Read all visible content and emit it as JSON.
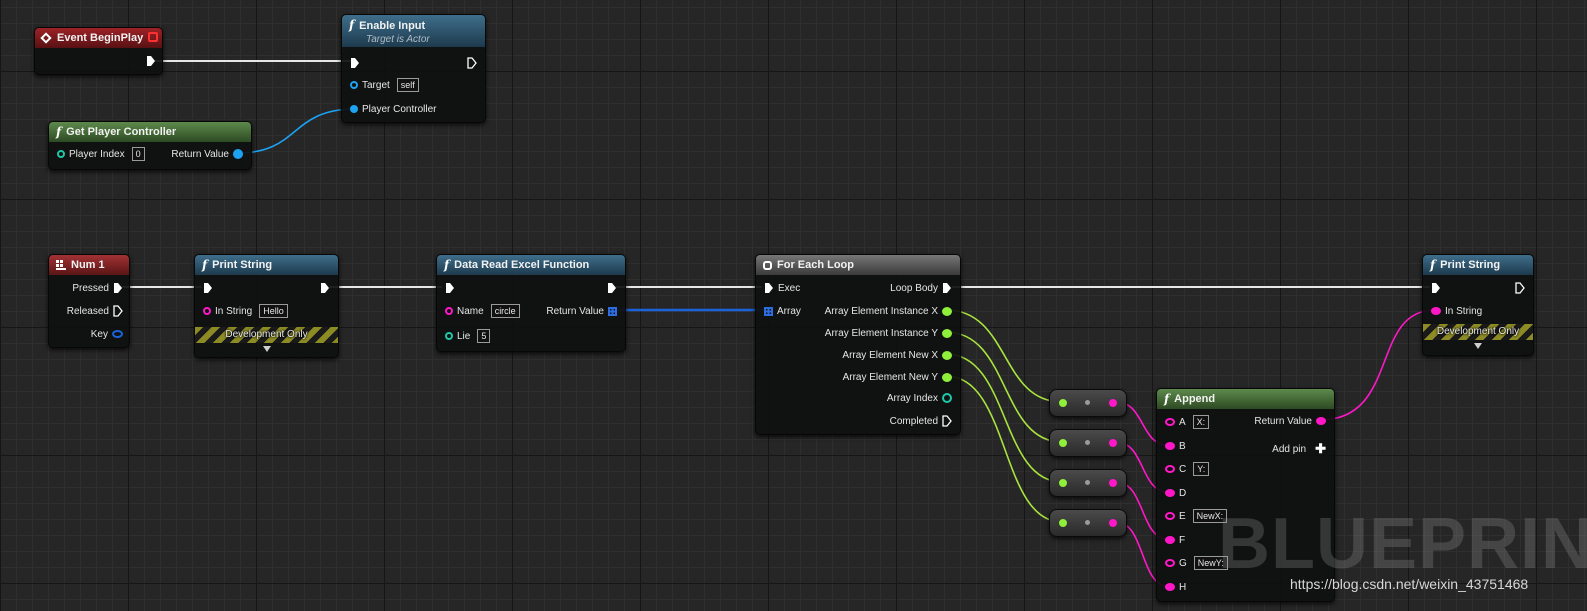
{
  "colors": {
    "exec": "#ffffff",
    "object": "#1ca3f2",
    "integer": "#1ec8a8",
    "string": "#ff17c8",
    "struct_float": "#8ef03a",
    "struct_array": "#1a63d8"
  },
  "nodes": {
    "event_begin_play": {
      "title": "Event BeginPlay",
      "icon": "event-diamond-icon"
    },
    "enable_input": {
      "title": "Enable Input",
      "subtitle": "Target is Actor",
      "target_label": "Target",
      "target_value": "self",
      "player_controller_label": "Player Controller",
      "icon": "function-icon"
    },
    "get_player_controller": {
      "title": "Get Player Controller",
      "player_index_label": "Player Index",
      "player_index_value": "0",
      "return_value_label": "Return Value",
      "icon": "function-icon"
    },
    "num1": {
      "title": "Num 1",
      "pressed_label": "Pressed",
      "released_label": "Released",
      "key_label": "Key",
      "icon": "keyboard-icon"
    },
    "print_string_1": {
      "title": "Print String",
      "in_string_label": "In String",
      "in_string_value": "Hello",
      "dev_label": "Development Only",
      "icon": "function-icon"
    },
    "data_read_excel": {
      "title": "Data Read Excel Function",
      "name_label": "Name",
      "name_value": "circle",
      "lie_label": "Lie",
      "lie_value": "5",
      "return_value_label": "Return Value",
      "icon": "function-icon"
    },
    "for_each_loop": {
      "title": "For Each Loop",
      "exec_label": "Exec",
      "array_label": "Array",
      "loop_body_label": "Loop Body",
      "out_ix_label": "Array Element Instance X",
      "out_iy_label": "Array Element Instance Y",
      "out_nx_label": "Array Element New X",
      "out_ny_label": "Array Element New Y",
      "index_label": "Array Index",
      "completed_label": "Completed",
      "icon": "loop-icon"
    },
    "append": {
      "title": "Append",
      "return_value_label": "Return Value",
      "add_pin_label": "Add pin",
      "pins": [
        {
          "label": "A",
          "value": "X:"
        },
        {
          "label": "B",
          "value": ""
        },
        {
          "label": "C",
          "value": "Y:"
        },
        {
          "label": "D",
          "value": ""
        },
        {
          "label": "E",
          "value": "NewX:"
        },
        {
          "label": "F",
          "value": ""
        },
        {
          "label": "G",
          "value": "NewY:"
        },
        {
          "label": "H",
          "value": ""
        }
      ],
      "icon": "function-icon"
    },
    "print_string_2": {
      "title": "Print String",
      "in_string_label": "In String",
      "dev_label": "Development Only",
      "icon": "function-icon"
    }
  },
  "watermark": "BLUEPRINT",
  "credit": "https://blog.csdn.net/weixin_43751468"
}
